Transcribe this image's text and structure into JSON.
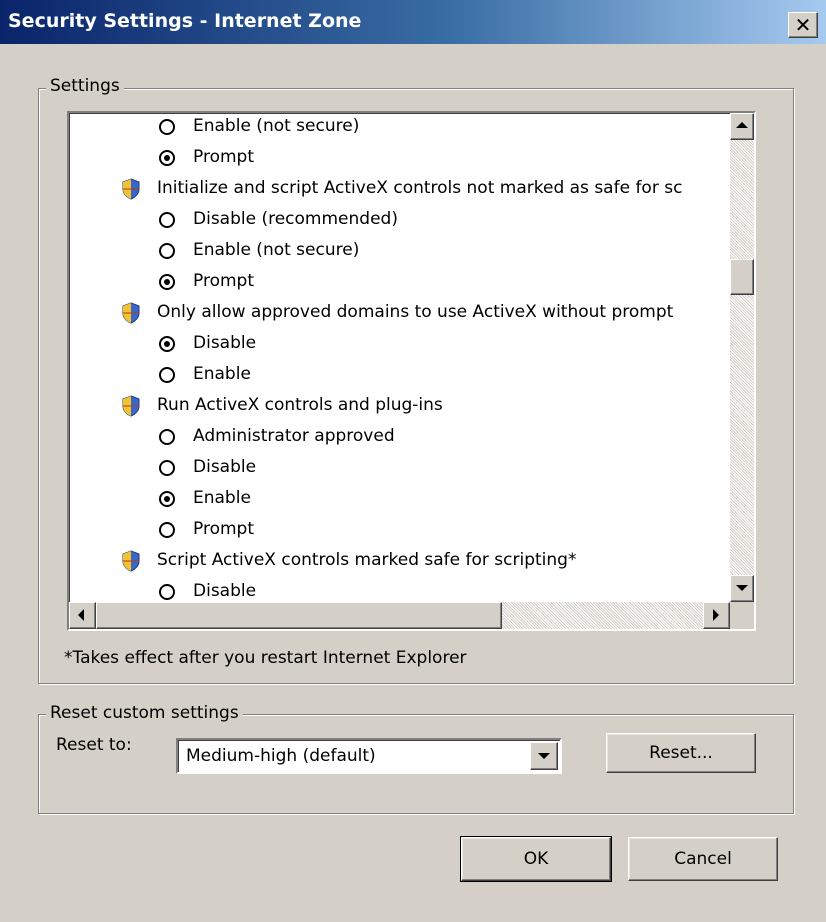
{
  "window": {
    "title": "Security Settings - Internet Zone"
  },
  "settings_group": {
    "legend": "Settings",
    "rows": [
      {
        "kind": "option",
        "label": "Enable (not secure)",
        "checked": false
      },
      {
        "kind": "option",
        "label": "Prompt",
        "checked": true
      },
      {
        "kind": "category",
        "label": "Initialize and script ActiveX controls not marked as safe for sc"
      },
      {
        "kind": "option",
        "label": "Disable (recommended)",
        "checked": false
      },
      {
        "kind": "option",
        "label": "Enable (not secure)",
        "checked": false
      },
      {
        "kind": "option",
        "label": "Prompt",
        "checked": true
      },
      {
        "kind": "category",
        "label": "Only allow approved domains to use ActiveX without prompt"
      },
      {
        "kind": "option",
        "label": "Disable",
        "checked": true
      },
      {
        "kind": "option",
        "label": "Enable",
        "checked": false
      },
      {
        "kind": "category",
        "label": "Run ActiveX controls and plug-ins"
      },
      {
        "kind": "option",
        "label": "Administrator approved",
        "checked": false
      },
      {
        "kind": "option",
        "label": "Disable",
        "checked": false
      },
      {
        "kind": "option",
        "label": "Enable",
        "checked": true
      },
      {
        "kind": "option",
        "label": "Prompt",
        "checked": false
      },
      {
        "kind": "category",
        "label": "Script ActiveX controls marked safe for scripting*"
      },
      {
        "kind": "option",
        "label": "Disable",
        "checked": false
      }
    ],
    "note": "*Takes effect after you restart Internet Explorer"
  },
  "reset_group": {
    "legend": "Reset custom settings",
    "reset_to_label": "Reset to:",
    "selected_level": "Medium-high (default)",
    "reset_button": "Reset..."
  },
  "buttons": {
    "ok": "OK",
    "cancel": "Cancel"
  },
  "icons": {
    "close": "close-icon",
    "category": "shield-icon",
    "radio": "radio-icon"
  }
}
